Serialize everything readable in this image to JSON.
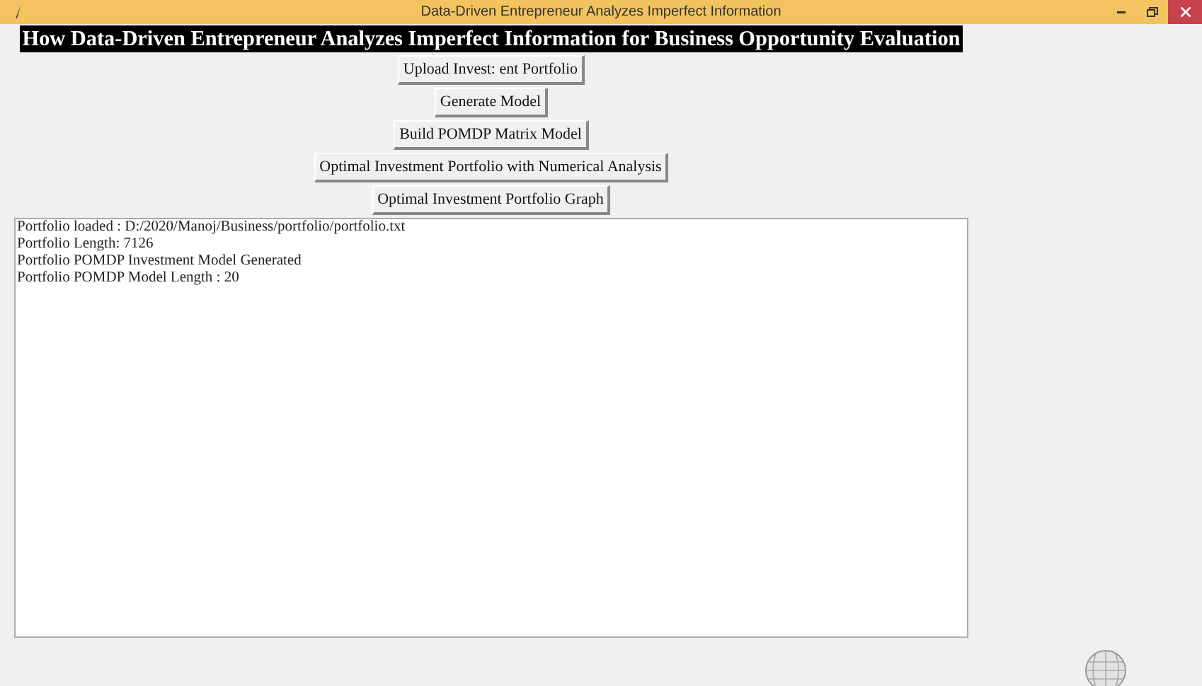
{
  "window": {
    "title": "Data-Driven Entrepreneur Analyzes Imperfect Information"
  },
  "heading": "How Data-Driven Entrepreneur Analyzes Imperfect Information for Business Opportunity Evaluation",
  "buttons": [
    "Upload Invest: ent Portfolio",
    "Generate Model",
    "Build POMDP Matrix Model",
    "Optimal Investment Portfolio with Numerical Analysis",
    "Optimal Investment Portfolio Graph"
  ],
  "output_lines": [
    "Portfolio loaded : D:/2020/Manoj/Business/portfolio/portfolio.txt",
    "Portfolio Length: 7126",
    "Portfolio POMDP Investment Model Generated",
    "Portfolio POMDP Model Length : 20"
  ]
}
